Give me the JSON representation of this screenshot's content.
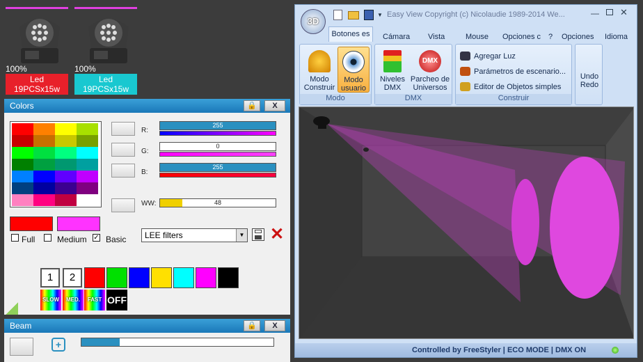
{
  "fixtures": [
    {
      "percent": "100%",
      "name": "Led",
      "model": "19PCSx15w",
      "color": "#e8202a"
    },
    {
      "percent": "100%",
      "name": "Led",
      "model": "19PCSx15w",
      "color": "#19c8d0"
    }
  ],
  "colors_panel": {
    "title": "Colors",
    "lock_icon": "lock-icon",
    "close_label": "X",
    "r_label": "R:",
    "g_label": "G:",
    "b_label": "B:",
    "ww_label": "WW:",
    "r_value": "255",
    "g_value": "0",
    "b_value": "255",
    "ww_value": "48",
    "ww_fraction": 0.19,
    "full_label": "Full",
    "medium_label": "Medium",
    "basic_label": "Basic",
    "full_checked": false,
    "medium_checked": false,
    "basic_checked": true,
    "filter_select": "LEE filters",
    "preset_1": "1",
    "preset_2": "2",
    "speed_labels": [
      "SLOW",
      "MED.",
      "FAST",
      "OFF"
    ],
    "current_color_a": "#ff0000",
    "current_color_b": "#ff33ff"
  },
  "beam_panel": {
    "title": "Beam",
    "close_label": "X",
    "value": "51",
    "fraction": 0.2
  },
  "window": {
    "title": "Easy View   Copyright (c) Nicolaudie 1989-2014   We...",
    "app_badge": "3D",
    "tabs": [
      "Botones es",
      "Cámara",
      "Vista",
      "Mouse",
      "Opciones c"
    ],
    "right_tabs": [
      "?",
      "Opciones",
      "Idioma"
    ],
    "groups": {
      "modo": {
        "caption": "Modo",
        "btn1": "Modo Construir",
        "btn2": "Modo usuario"
      },
      "dmx": {
        "caption": "DMX",
        "btn1": "Niveles DMX",
        "btn2": "Parcheo de Universos",
        "dmx_badge": "DMX"
      },
      "construir": {
        "caption": "Construir",
        "items": [
          "Agregar Luz",
          "Parámetros de escenario...",
          "Editor de Objetos simples"
        ]
      },
      "undo": {
        "label": "Undo Redo"
      }
    },
    "status": {
      "text": "Controlled by FreeStyler   |   ECO MODE   |   DMX ON"
    }
  },
  "palette": [
    "#ff0000",
    "#ff8000",
    "#ffff00",
    "#a8e000",
    "#c80000",
    "#c87000",
    "#c8c800",
    "#78a000",
    "#00ff00",
    "#00e040",
    "#00ff80",
    "#00ffff",
    "#008000",
    "#00a040",
    "#009870",
    "#00a0a0",
    "#0080ff",
    "#0000ff",
    "#6000ff",
    "#c000ff",
    "#004080",
    "#0000a0",
    "#3c0090",
    "#800080",
    "#ff80c0",
    "#ff0080",
    "#c00040",
    "#ffffff"
  ],
  "swatch_colors": [
    "#ff0000",
    "#00e000",
    "#0000ff",
    "#ffe000",
    "#00ffff",
    "#ff00ff",
    "#000000"
  ]
}
